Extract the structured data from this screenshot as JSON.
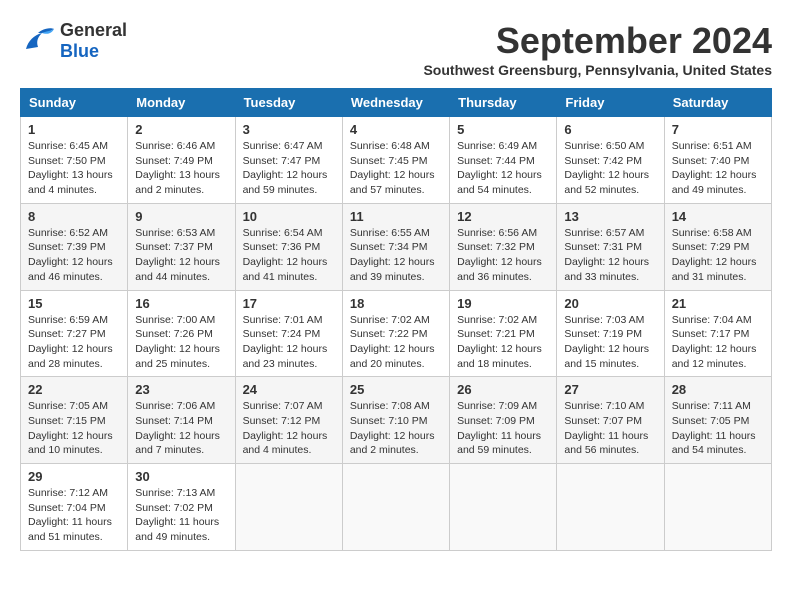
{
  "header": {
    "logo": {
      "general": "General",
      "blue": "Blue"
    },
    "title": "September 2024",
    "location": "Southwest Greensburg, Pennsylvania, United States"
  },
  "days_of_week": [
    "Sunday",
    "Monday",
    "Tuesday",
    "Wednesday",
    "Thursday",
    "Friday",
    "Saturday"
  ],
  "weeks": [
    [
      {
        "day": "1",
        "sunrise": "6:45 AM",
        "sunset": "7:50 PM",
        "daylight": "13 hours and 4 minutes."
      },
      {
        "day": "2",
        "sunrise": "6:46 AM",
        "sunset": "7:49 PM",
        "daylight": "13 hours and 2 minutes."
      },
      {
        "day": "3",
        "sunrise": "6:47 AM",
        "sunset": "7:47 PM",
        "daylight": "12 hours and 59 minutes."
      },
      {
        "day": "4",
        "sunrise": "6:48 AM",
        "sunset": "7:45 PM",
        "daylight": "12 hours and 57 minutes."
      },
      {
        "day": "5",
        "sunrise": "6:49 AM",
        "sunset": "7:44 PM",
        "daylight": "12 hours and 54 minutes."
      },
      {
        "day": "6",
        "sunrise": "6:50 AM",
        "sunset": "7:42 PM",
        "daylight": "12 hours and 52 minutes."
      },
      {
        "day": "7",
        "sunrise": "6:51 AM",
        "sunset": "7:40 PM",
        "daylight": "12 hours and 49 minutes."
      }
    ],
    [
      {
        "day": "8",
        "sunrise": "6:52 AM",
        "sunset": "7:39 PM",
        "daylight": "12 hours and 46 minutes."
      },
      {
        "day": "9",
        "sunrise": "6:53 AM",
        "sunset": "7:37 PM",
        "daylight": "12 hours and 44 minutes."
      },
      {
        "day": "10",
        "sunrise": "6:54 AM",
        "sunset": "7:36 PM",
        "daylight": "12 hours and 41 minutes."
      },
      {
        "day": "11",
        "sunrise": "6:55 AM",
        "sunset": "7:34 PM",
        "daylight": "12 hours and 39 minutes."
      },
      {
        "day": "12",
        "sunrise": "6:56 AM",
        "sunset": "7:32 PM",
        "daylight": "12 hours and 36 minutes."
      },
      {
        "day": "13",
        "sunrise": "6:57 AM",
        "sunset": "7:31 PM",
        "daylight": "12 hours and 33 minutes."
      },
      {
        "day": "14",
        "sunrise": "6:58 AM",
        "sunset": "7:29 PM",
        "daylight": "12 hours and 31 minutes."
      }
    ],
    [
      {
        "day": "15",
        "sunrise": "6:59 AM",
        "sunset": "7:27 PM",
        "daylight": "12 hours and 28 minutes."
      },
      {
        "day": "16",
        "sunrise": "7:00 AM",
        "sunset": "7:26 PM",
        "daylight": "12 hours and 25 minutes."
      },
      {
        "day": "17",
        "sunrise": "7:01 AM",
        "sunset": "7:24 PM",
        "daylight": "12 hours and 23 minutes."
      },
      {
        "day": "18",
        "sunrise": "7:02 AM",
        "sunset": "7:22 PM",
        "daylight": "12 hours and 20 minutes."
      },
      {
        "day": "19",
        "sunrise": "7:02 AM",
        "sunset": "7:21 PM",
        "daylight": "12 hours and 18 minutes."
      },
      {
        "day": "20",
        "sunrise": "7:03 AM",
        "sunset": "7:19 PM",
        "daylight": "12 hours and 15 minutes."
      },
      {
        "day": "21",
        "sunrise": "7:04 AM",
        "sunset": "7:17 PM",
        "daylight": "12 hours and 12 minutes."
      }
    ],
    [
      {
        "day": "22",
        "sunrise": "7:05 AM",
        "sunset": "7:15 PM",
        "daylight": "12 hours and 10 minutes."
      },
      {
        "day": "23",
        "sunrise": "7:06 AM",
        "sunset": "7:14 PM",
        "daylight": "12 hours and 7 minutes."
      },
      {
        "day": "24",
        "sunrise": "7:07 AM",
        "sunset": "7:12 PM",
        "daylight": "12 hours and 4 minutes."
      },
      {
        "day": "25",
        "sunrise": "7:08 AM",
        "sunset": "7:10 PM",
        "daylight": "12 hours and 2 minutes."
      },
      {
        "day": "26",
        "sunrise": "7:09 AM",
        "sunset": "7:09 PM",
        "daylight": "11 hours and 59 minutes."
      },
      {
        "day": "27",
        "sunrise": "7:10 AM",
        "sunset": "7:07 PM",
        "daylight": "11 hours and 56 minutes."
      },
      {
        "day": "28",
        "sunrise": "7:11 AM",
        "sunset": "7:05 PM",
        "daylight": "11 hours and 54 minutes."
      }
    ],
    [
      {
        "day": "29",
        "sunrise": "7:12 AM",
        "sunset": "7:04 PM",
        "daylight": "11 hours and 51 minutes."
      },
      {
        "day": "30",
        "sunrise": "7:13 AM",
        "sunset": "7:02 PM",
        "daylight": "11 hours and 49 minutes."
      },
      null,
      null,
      null,
      null,
      null
    ]
  ],
  "labels": {
    "sunrise": "Sunrise:",
    "sunset": "Sunset:",
    "daylight": "Daylight:"
  }
}
